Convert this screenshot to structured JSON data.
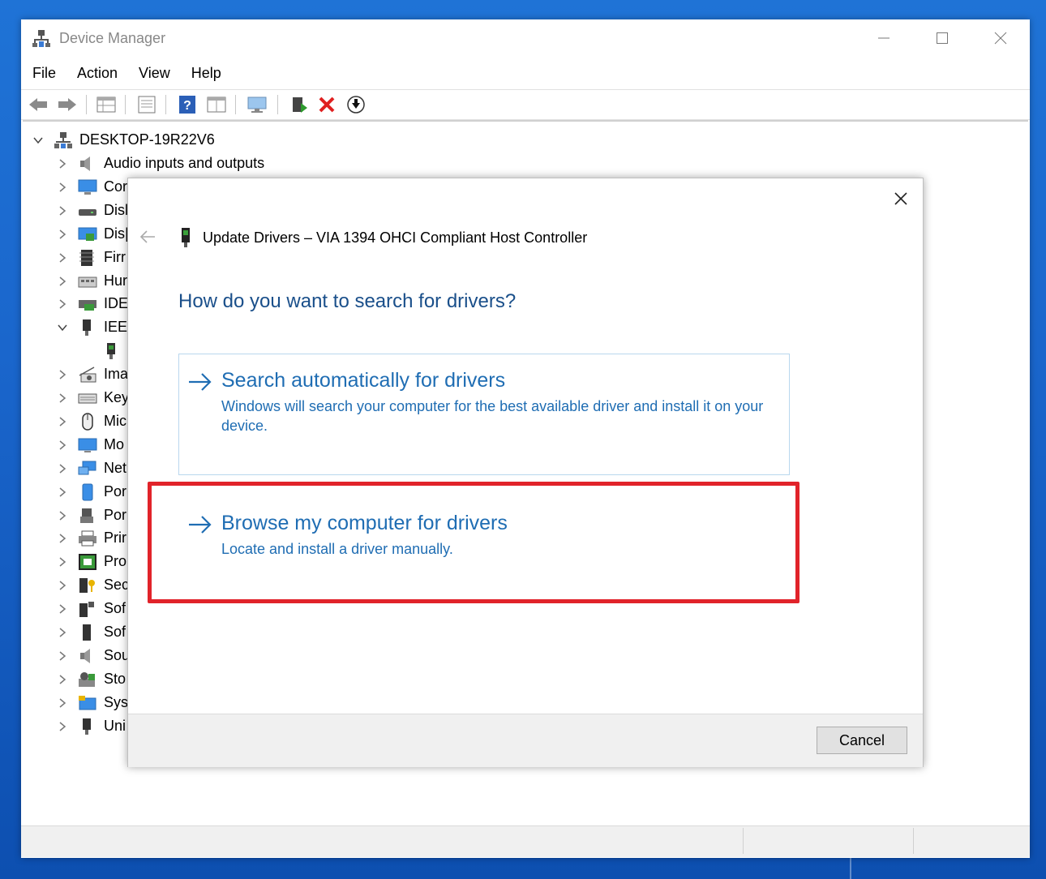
{
  "window": {
    "title": "Device Manager"
  },
  "menu": [
    "File",
    "Action",
    "View",
    "Help"
  ],
  "toolbar_icons": [
    "back-arrow-icon",
    "forward-arrow-icon",
    "properties-grid-icon",
    "list-icon",
    "help-icon",
    "view-grid-icon",
    "monitor-icon",
    "update-driver-icon",
    "uninstall-x-icon",
    "download-circle-icon"
  ],
  "tree": {
    "root": "DESKTOP-19R22V6",
    "items": [
      {
        "label": "Audio inputs and outputs",
        "expanded": false,
        "icon": "speaker-icon"
      },
      {
        "label": "Cor",
        "expanded": false,
        "icon": "computer-icon"
      },
      {
        "label": "Disl",
        "expanded": false,
        "icon": "disk-icon"
      },
      {
        "label": "Dis|",
        "expanded": false,
        "icon": "display-adapter-icon"
      },
      {
        "label": "Firr",
        "expanded": false,
        "icon": "firmware-icon"
      },
      {
        "label": "Hur",
        "expanded": false,
        "icon": "hid-icon"
      },
      {
        "label": "IDE",
        "expanded": false,
        "icon": "ide-icon"
      },
      {
        "label": "IEEI",
        "expanded": true,
        "icon": "ieee-icon"
      },
      {
        "label": "",
        "expanded": null,
        "icon": "ieee-device-icon"
      },
      {
        "label": "Ima",
        "expanded": false,
        "icon": "imaging-icon"
      },
      {
        "label": "Key",
        "expanded": false,
        "icon": "keyboard-icon"
      },
      {
        "label": "Mic",
        "expanded": false,
        "icon": "mouse-icon"
      },
      {
        "label": "Mo",
        "expanded": false,
        "icon": "monitor-icon"
      },
      {
        "label": "Net",
        "expanded": false,
        "icon": "network-icon"
      },
      {
        "label": "Por",
        "expanded": false,
        "icon": "portable-icon"
      },
      {
        "label": "Por",
        "expanded": false,
        "icon": "ports-icon"
      },
      {
        "label": "Prir",
        "expanded": false,
        "icon": "printer-icon"
      },
      {
        "label": "Pro",
        "expanded": false,
        "icon": "processor-icon"
      },
      {
        "label": "Sec",
        "expanded": false,
        "icon": "security-icon"
      },
      {
        "label": "Sof",
        "expanded": false,
        "icon": "software-component-icon"
      },
      {
        "label": "Sof",
        "expanded": false,
        "icon": "software-device-icon"
      },
      {
        "label": "Sou",
        "expanded": false,
        "icon": "sound-icon"
      },
      {
        "label": "Sto",
        "expanded": false,
        "icon": "storage-icon"
      },
      {
        "label": "Sys",
        "expanded": false,
        "icon": "system-icon"
      },
      {
        "label": "Uni",
        "expanded": false,
        "icon": "usb-icon"
      }
    ]
  },
  "dialog": {
    "title": "Update Drivers – VIA 1394 OHCI Compliant Host Controller",
    "heading": "How do you want to search for drivers?",
    "options": [
      {
        "title": "Search automatically for drivers",
        "desc": "Windows will search your computer for the best available driver and install it on your device."
      },
      {
        "title": "Browse my computer for drivers",
        "desc": "Locate and install a driver manually."
      }
    ],
    "cancel": "Cancel"
  },
  "colors": {
    "link_blue": "#1f6db3",
    "heading_blue": "#1a4f8a",
    "highlight_red": "#e1232a",
    "desktop_blue": "#1a66cc"
  }
}
